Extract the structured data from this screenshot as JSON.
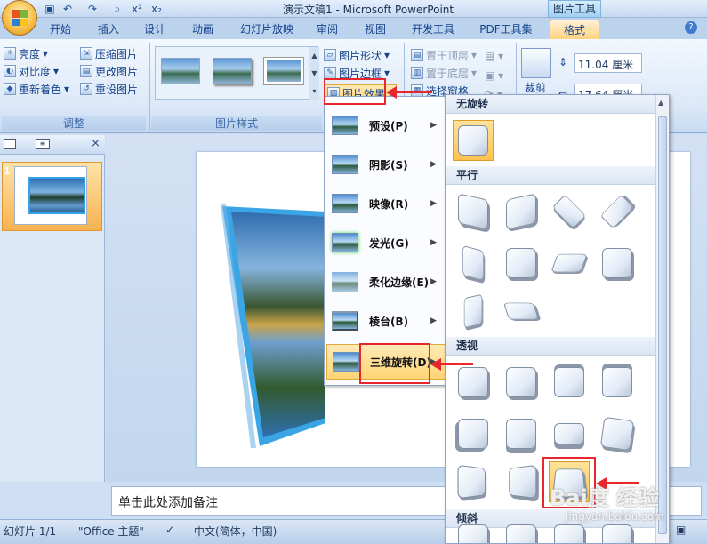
{
  "window": {
    "title": "演示文稿1 - Microsoft PowerPoint",
    "context_tool": "图片工具"
  },
  "quick_access": {
    "save": "save-icon",
    "undo": "undo-icon",
    "redo": "redo-icon",
    "preview": "print-preview-icon",
    "superscript": "x²",
    "subscript": "x₂"
  },
  "tabs": [
    "开始",
    "插入",
    "设计",
    "动画",
    "幻灯片放映",
    "审阅",
    "视图",
    "开发工具",
    "PDF工具集",
    "格式"
  ],
  "active_tab": "格式",
  "ribbon": {
    "adjust": {
      "brightness": "亮度",
      "contrast": "对比度",
      "recolor": "重新着色",
      "compress": "压缩图片",
      "change": "更改图片",
      "reset": "重设图片",
      "label": "调整"
    },
    "styles": {
      "label": "图片样式"
    },
    "picture": {
      "shape": "图片形状",
      "border": "图片边框",
      "effects": "图片效果"
    },
    "arrange": {
      "bring_front": "置于顶层",
      "send_back": "置于底层",
      "selection_pane": "选择窗格"
    },
    "size": {
      "crop": "裁剪",
      "height": "11.04 厘米",
      "width": "17.64 厘米"
    }
  },
  "effects_menu": {
    "items": [
      {
        "label": "预设(P)"
      },
      {
        "label": "阴影(S)"
      },
      {
        "label": "映像(R)"
      },
      {
        "label": "发光(G)"
      },
      {
        "label": "柔化边缘(E)"
      },
      {
        "label": "棱台(B)"
      },
      {
        "label": "三维旋转(D)"
      }
    ]
  },
  "rotation_gallery": {
    "sections": [
      "无旋转",
      "平行",
      "透视",
      "倾斜"
    ]
  },
  "slide_pane": {
    "slide_number": "1"
  },
  "notes": {
    "placeholder": "单击此处添加备注"
  },
  "status": {
    "slide": "幻灯片 1/1",
    "theme": "\"Office 主题\"",
    "language": "中文(简体，中国)"
  },
  "watermark": {
    "text": "Bai度 经验",
    "url": "jingyan.baidu.com"
  }
}
